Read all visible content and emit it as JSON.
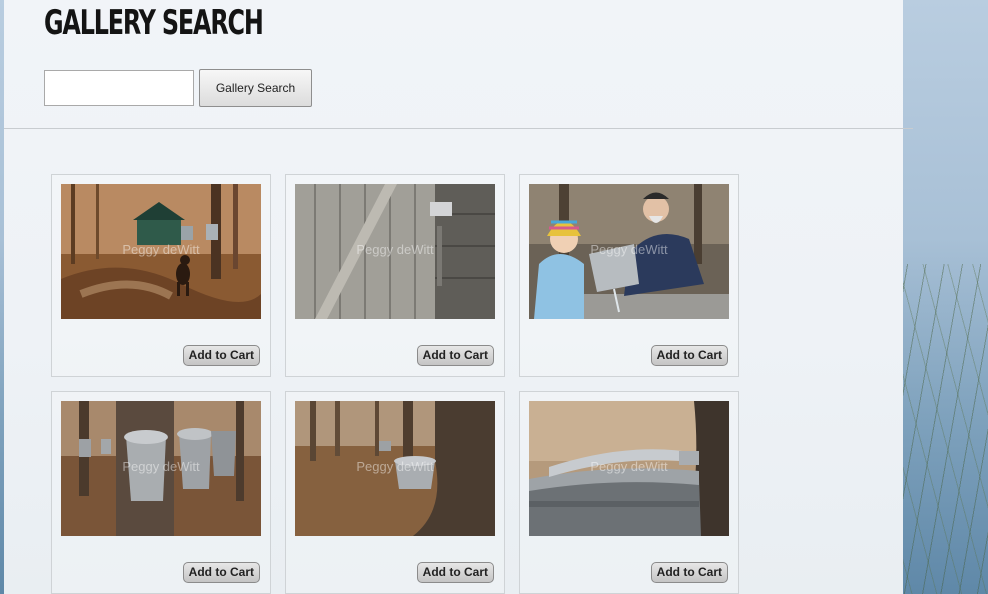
{
  "page": {
    "title": "GALLERY SEARCH"
  },
  "search": {
    "value": "",
    "placeholder": "",
    "button_label": "Gallery Search"
  },
  "gallery": {
    "items": [
      {
        "watermark": "Peggy deWitt",
        "icon": "photo-dog-sugarhouse",
        "cart_label": "Add to Cart"
      },
      {
        "watermark": "Peggy deWitt",
        "icon": "photo-wooden-door",
        "cart_label": "Add to Cart"
      },
      {
        "watermark": "Peggy deWitt",
        "icon": "photo-girl-man-sap",
        "cart_label": "Add to Cart"
      },
      {
        "watermark": "Peggy deWitt",
        "icon": "photo-sap-buckets",
        "cart_label": "Add to Cart"
      },
      {
        "watermark": "Peggy deWitt",
        "icon": "photo-bucket-on-tree",
        "cart_label": "Add to Cart"
      },
      {
        "watermark": "Peggy deWitt",
        "icon": "photo-bucket-closeup",
        "cart_label": "Add to Cart"
      }
    ]
  }
}
